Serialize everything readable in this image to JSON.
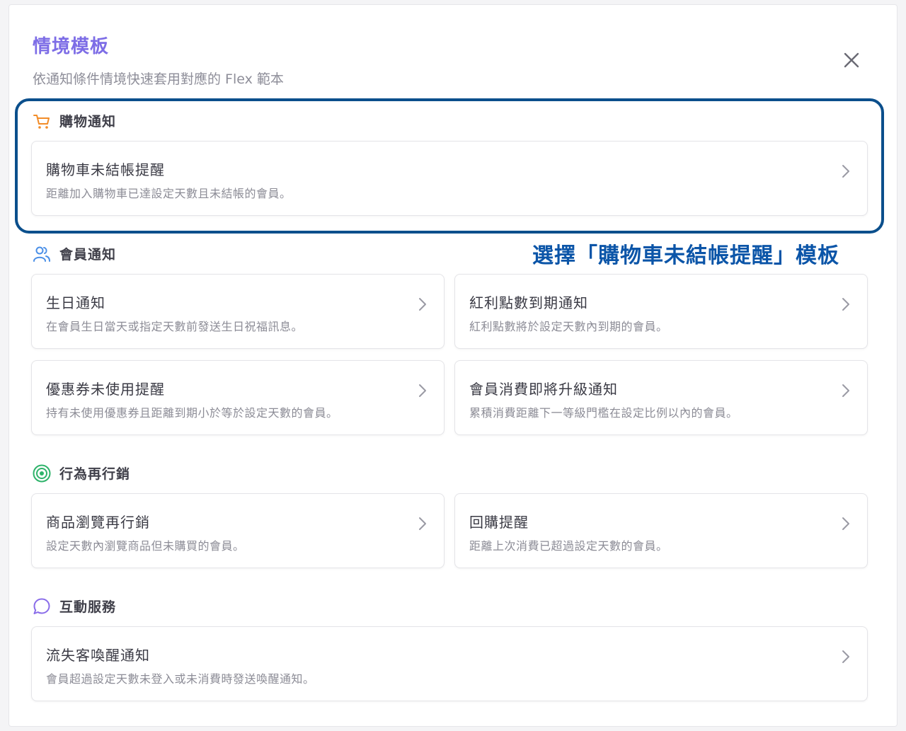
{
  "modal": {
    "title": "情境模板",
    "subtitle": "依通知條件情境快速套用對應的 Flex 範本",
    "close_icon": "close-icon"
  },
  "sections": {
    "shopping": {
      "label": "購物通知",
      "icon": "shopping-cart-icon",
      "color": "#f28c28",
      "cards": [
        {
          "title": "購物車未結帳提醒",
          "desc": "距離加入購物車已達設定天數且未結帳的會員。"
        }
      ]
    },
    "member": {
      "label": "會員通知",
      "icon": "users-icon",
      "color": "#4a8fe7",
      "cards": [
        {
          "title": "生日通知",
          "desc": "在會員生日當天或指定天數前發送生日祝福訊息。"
        },
        {
          "title": "紅利點數到期通知",
          "desc": "紅利點數將於設定天數內到期的會員。"
        },
        {
          "title": "優惠券未使用提醒",
          "desc": "持有未使用優惠券且距離到期小於等於設定天數的會員。"
        },
        {
          "title": "會員消費即將升級通知",
          "desc": "累積消費距離下一等級門檻在設定比例以內的會員。"
        }
      ]
    },
    "remarketing": {
      "label": "行為再行銷",
      "icon": "target-icon",
      "color": "#2fb36b",
      "cards": [
        {
          "title": "商品瀏覽再行銷",
          "desc": "設定天數內瀏覽商品但未購買的會員。"
        },
        {
          "title": "回購提醒",
          "desc": "距離上次消費已超過設定天數的會員。"
        }
      ]
    },
    "interaction": {
      "label": "互動服務",
      "icon": "chat-bubble-icon",
      "color": "#8a6de9",
      "cards": [
        {
          "title": "流失客喚醒通知",
          "desc": "會員超過設定天數未登入或未消費時發送喚醒通知。"
        }
      ]
    }
  },
  "annotation": {
    "text": "選擇「購物車未結帳提醒」模板",
    "color": "#0b55a8"
  },
  "colors": {
    "title": "#7d6de6",
    "highlight_border": "#0b4f8c"
  }
}
